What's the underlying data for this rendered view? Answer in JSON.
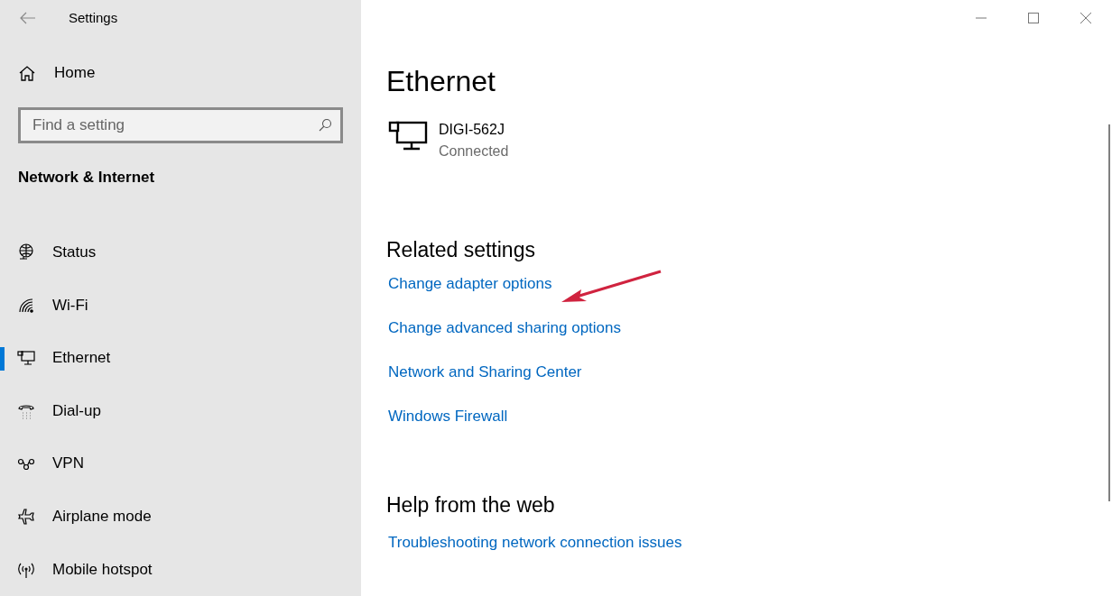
{
  "window": {
    "title": "Settings"
  },
  "sidebar": {
    "home": "Home",
    "search": {
      "placeholder": "Find a setting"
    },
    "section": "Network & Internet",
    "items": [
      {
        "label": "Status",
        "kind": "globe",
        "selected": false
      },
      {
        "label": "Wi-Fi",
        "kind": "wifi",
        "selected": false
      },
      {
        "label": "Ethernet",
        "kind": "ethernet",
        "selected": true
      },
      {
        "label": "Dial-up",
        "kind": "phone",
        "selected": false
      },
      {
        "label": "VPN",
        "kind": "vpn",
        "selected": false
      },
      {
        "label": "Airplane mode",
        "kind": "airplane",
        "selected": false
      },
      {
        "label": "Mobile hotspot",
        "kind": "hotspot",
        "selected": false
      }
    ]
  },
  "main": {
    "title": "Ethernet",
    "connection": {
      "name": "DIGI-562J",
      "status": "Connected"
    },
    "related": {
      "heading": "Related settings",
      "links": [
        "Change adapter options",
        "Change advanced sharing options",
        "Network and Sharing Center",
        "Windows Firewall"
      ]
    },
    "help": {
      "heading": "Help from the web",
      "links": [
        "Troubleshooting network connection issues"
      ]
    }
  }
}
